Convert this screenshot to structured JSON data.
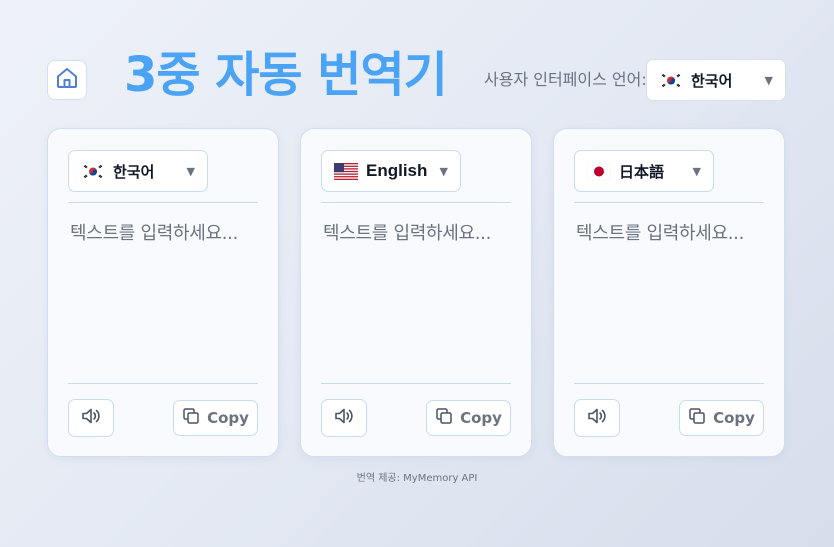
{
  "header": {
    "title": "3중 자동 번역기",
    "ui_language_label": "사용자 인터페이스 언어:",
    "ui_language_selected": "한국어",
    "ui_language_flag": "korea-flag-icon"
  },
  "panels": [
    {
      "language": "한국어",
      "flag": "korea-flag-icon",
      "placeholder": "텍스트를 입력하세요...",
      "copy_label": "Copy"
    },
    {
      "language": "English",
      "flag": "usa-flag-icon",
      "placeholder": "텍스트를 입력하세요...",
      "copy_label": "Copy"
    },
    {
      "language": "日本語",
      "flag": "japan-flag-icon",
      "placeholder": "텍스트를 입력하세요...",
      "copy_label": "Copy"
    }
  ],
  "footer": {
    "credit": "번역 제공: MyMemory API"
  },
  "colors": {
    "title": "#4aa3f5",
    "border": "#c8dcf0"
  }
}
